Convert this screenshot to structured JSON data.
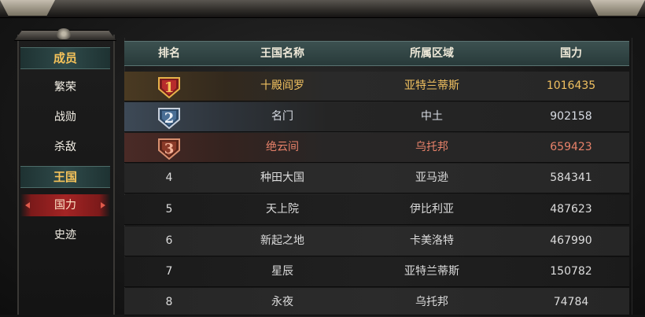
{
  "menu": {
    "sections": [
      {
        "header": "成员",
        "items": [
          "繁荣",
          "战勋",
          "杀敌"
        ]
      },
      {
        "header": "王国",
        "items": [
          "国力",
          "史迹"
        ]
      }
    ],
    "active_item": "国力"
  },
  "table": {
    "columns": [
      "排名",
      "王国名称",
      "所属区域",
      "国力"
    ],
    "rows": [
      {
        "rank": "1",
        "name": "十殿阎罗",
        "region": "亚特兰蒂斯",
        "power": "1016435",
        "medal": "gold"
      },
      {
        "rank": "2",
        "name": "名门",
        "region": "中土",
        "power": "902158",
        "medal": "silver"
      },
      {
        "rank": "3",
        "name": "绝云间",
        "region": "乌托邦",
        "power": "659423",
        "medal": "bronze"
      },
      {
        "rank": "4",
        "name": "种田大国",
        "region": "亚马逊",
        "power": "584341"
      },
      {
        "rank": "5",
        "name": "天上院",
        "region": "伊比利亚",
        "power": "487623"
      },
      {
        "rank": "6",
        "name": "新起之地",
        "region": "卡美洛特",
        "power": "467990"
      },
      {
        "rank": "7",
        "name": "星辰",
        "region": "亚特兰蒂斯",
        "power": "150782"
      },
      {
        "rank": "8",
        "name": "永夜",
        "region": "乌托邦",
        "power": "74784"
      }
    ]
  },
  "colors": {
    "gold": "#f0c060",
    "silver": "#d8dce4",
    "bronze": "#e8826a",
    "menu_header_text": "#f6c35a",
    "active_item_bg": "#a32424",
    "header_bg": "#324848"
  }
}
